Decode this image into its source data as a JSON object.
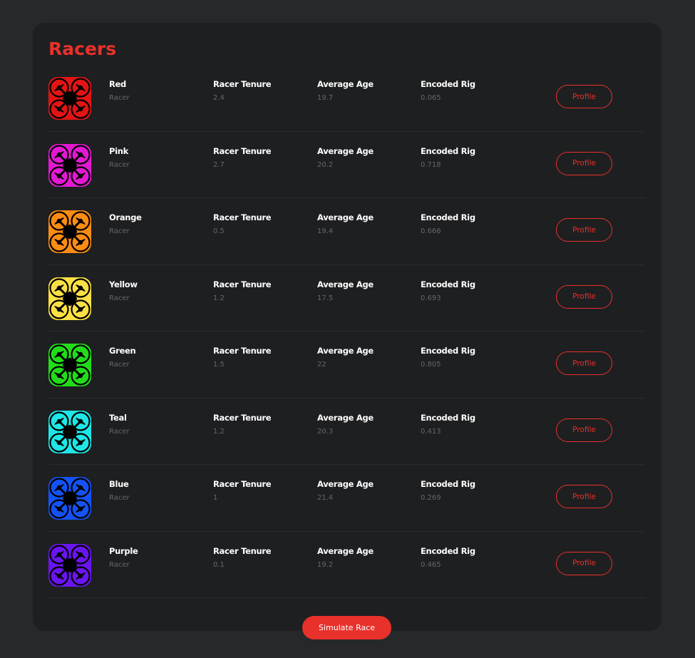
{
  "page": {
    "title": "Racers"
  },
  "columns": {
    "tenure": "Racer Tenure",
    "age": "Average Age",
    "rig": "Encoded Rig"
  },
  "racers": [
    {
      "name": "Red",
      "role": "Racer",
      "tenure": "2.4",
      "age": "19.7",
      "rig": "0.065",
      "color": "#e21414",
      "button": "Profile"
    },
    {
      "name": "Pink",
      "role": "Racer",
      "tenure": "2.7",
      "age": "20.2",
      "rig": "0.718",
      "color": "#e318d2",
      "button": "Profile"
    },
    {
      "name": "Orange",
      "role": "Racer",
      "tenure": "0.5",
      "age": "19.4",
      "rig": "0.666",
      "color": "#fb8c14",
      "button": "Profile"
    },
    {
      "name": "Yellow",
      "role": "Racer",
      "tenure": "1.2",
      "age": "17.5",
      "rig": "0.693",
      "color": "#fbe044",
      "button": "Profile"
    },
    {
      "name": "Green",
      "role": "Racer",
      "tenure": "1.5",
      "age": "22",
      "rig": "0.805",
      "color": "#22dc1a",
      "button": "Profile"
    },
    {
      "name": "Teal",
      "role": "Racer",
      "tenure": "1.2",
      "age": "20.3",
      "rig": "0.413",
      "color": "#1ee6e6",
      "button": "Profile"
    },
    {
      "name": "Blue",
      "role": "Racer",
      "tenure": "1",
      "age": "21.4",
      "rig": "0.269",
      "color": "#1452f5",
      "button": "Profile"
    },
    {
      "name": "Purple",
      "role": "Racer",
      "tenure": "0.1",
      "age": "19.2",
      "rig": "0.465",
      "color": "#6a14f0",
      "button": "Profile"
    }
  ],
  "actions": {
    "simulate": "Simulate Race"
  },
  "icons": {
    "racer_avatar": "drone-icon"
  }
}
